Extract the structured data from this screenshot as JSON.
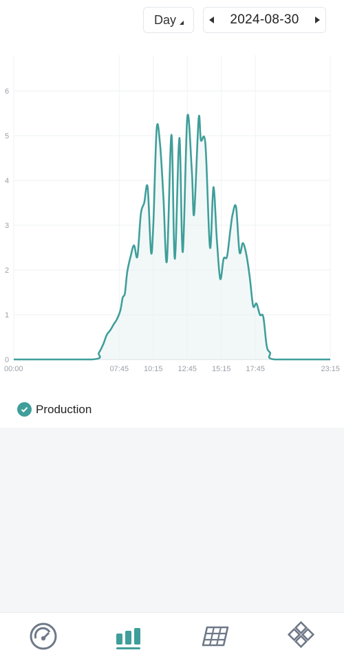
{
  "header": {
    "range_label": "Day",
    "date": "2024-08-30"
  },
  "chart_data": {
    "type": "area",
    "series": [
      {
        "name": "Production",
        "color": "#3f9e9a",
        "points": [
          [
            "00:00",
            0
          ],
          [
            "05:45",
            0
          ],
          [
            "06:15",
            0.15
          ],
          [
            "06:35",
            0.35
          ],
          [
            "06:50",
            0.55
          ],
          [
            "07:05",
            0.65
          ],
          [
            "07:20",
            0.78
          ],
          [
            "07:35",
            0.9
          ],
          [
            "07:50",
            1.1
          ],
          [
            "08:00",
            1.38
          ],
          [
            "08:10",
            1.48
          ],
          [
            "08:20",
            1.95
          ],
          [
            "08:35",
            2.3
          ],
          [
            "08:50",
            2.55
          ],
          [
            "09:05",
            2.3
          ],
          [
            "09:20",
            3.25
          ],
          [
            "09:35",
            3.5
          ],
          [
            "09:50",
            3.85
          ],
          [
            "10:05",
            2.4
          ],
          [
            "10:15",
            3.0
          ],
          [
            "10:30",
            5.15
          ],
          [
            "10:45",
            4.8
          ],
          [
            "11:00",
            3.6
          ],
          [
            "11:15",
            2.2
          ],
          [
            "11:35",
            5.02
          ],
          [
            "11:50",
            2.25
          ],
          [
            "12:10",
            4.95
          ],
          [
            "12:25",
            2.4
          ],
          [
            "12:45",
            5.42
          ],
          [
            "13:05",
            4.2
          ],
          [
            "13:15",
            3.25
          ],
          [
            "13:35",
            5.38
          ],
          [
            "13:45",
            4.9
          ],
          [
            "14:05",
            4.8
          ],
          [
            "14:25",
            2.5
          ],
          [
            "14:40",
            3.85
          ],
          [
            "14:55",
            2.7
          ],
          [
            "15:10",
            1.8
          ],
          [
            "15:25",
            2.25
          ],
          [
            "15:40",
            2.3
          ],
          [
            "15:55",
            2.9
          ],
          [
            "16:05",
            3.25
          ],
          [
            "16:20",
            3.4
          ],
          [
            "16:35",
            2.4
          ],
          [
            "16:50",
            2.6
          ],
          [
            "17:05",
            2.35
          ],
          [
            "17:20",
            1.85
          ],
          [
            "17:35",
            1.2
          ],
          [
            "17:50",
            1.25
          ],
          [
            "18:05",
            1.0
          ],
          [
            "18:20",
            0.95
          ],
          [
            "18:35",
            0.3
          ],
          [
            "18:50",
            0.15
          ],
          [
            "19:10",
            0
          ],
          [
            "23:15",
            0
          ]
        ]
      }
    ],
    "x_ticks": [
      "00:00",
      "07:45",
      "10:15",
      "12:45",
      "15:15",
      "17:45",
      "23:15"
    ],
    "y_ticks": [
      "0",
      "1",
      "2",
      "3",
      "4",
      "5",
      "6"
    ],
    "ylim": [
      0,
      6.8
    ],
    "grid": true,
    "legend": "bottom-left"
  },
  "legend": {
    "production_label": "Production"
  },
  "nav": {
    "items": [
      {
        "icon": "speedometer-icon"
      },
      {
        "icon": "bar-chart-icon",
        "active": true,
        "color": "#3f9e9a"
      },
      {
        "icon": "solar-panel-icon"
      },
      {
        "icon": "diamond-grid-icon"
      }
    ]
  }
}
